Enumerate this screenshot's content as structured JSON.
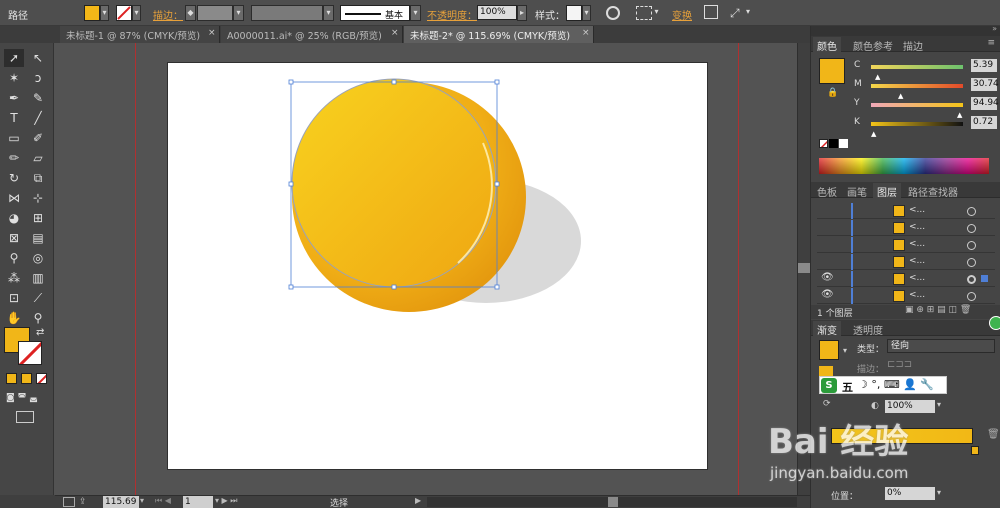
{
  "control_bar": {
    "object_type": "路径",
    "stroke_label": "描边：",
    "stroke_style": "基本",
    "opacity_label": "不透明度：",
    "opacity_value": "100%",
    "style_label": "样式：",
    "transform_label": "变换",
    "fill_color": "#f3b718"
  },
  "doc_tabs": [
    {
      "label": "未标题-1 @ 87% (CMYK/预览)",
      "active": false
    },
    {
      "label": "A0000011.ai* @ 25% (RGB/预览)",
      "active": false
    },
    {
      "label": "未标题-2* @ 115.69% (CMYK/预览)",
      "active": true
    }
  ],
  "tab_close": "×",
  "status_bar": {
    "zoom": "115.69",
    "page": "1",
    "tool_name": "选择"
  },
  "color_panel": {
    "tabs": [
      "颜色",
      "颜色参考",
      "描边"
    ],
    "channels": [
      {
        "name": "C",
        "value": "5.39"
      },
      {
        "name": "M",
        "value": "30.74"
      },
      {
        "name": "Y",
        "value": "94.94"
      },
      {
        "name": "K",
        "value": "0.72"
      }
    ]
  },
  "layers_panel": {
    "tabs": [
      "色板",
      "画笔",
      "图层",
      "路径查找器"
    ],
    "row_names": [
      "<...",
      "<...",
      "<...",
      "<...",
      "<...",
      "<..."
    ],
    "footer": "1 个图层"
  },
  "gradient_panel": {
    "tabs": [
      "渐变",
      "透明度"
    ],
    "type_label": "类型：",
    "type_value": "径向",
    "stroke_label": "描边：",
    "opacity_value": "100%",
    "position_label": "位置：",
    "position_value": "0%"
  },
  "ime_toolbar": {
    "logo": "S",
    "mode": "五"
  },
  "watermark": {
    "brand": "Bai 经验",
    "url": "jingyan.baidu.com"
  },
  "colors": {
    "coin_main": "#f1b618",
    "coin_dark": "#e79b10",
    "shadow": "#d9d9d9",
    "selection": "#4f7fd6",
    "accent_orange": "#e8a13a"
  }
}
